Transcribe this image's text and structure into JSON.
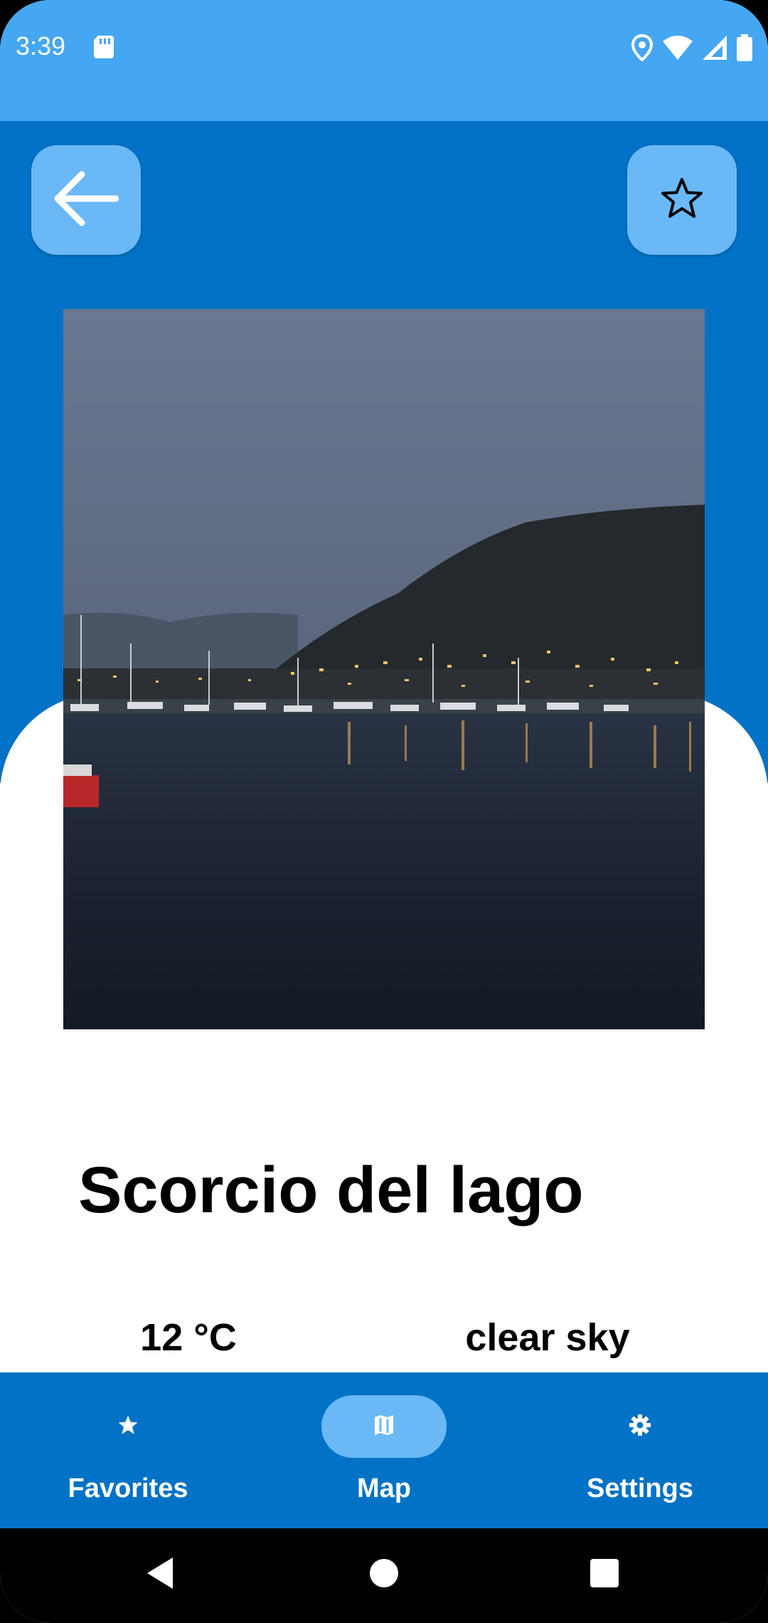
{
  "status_bar": {
    "time": "3:39",
    "icons": [
      "sd-card-icon",
      "location-icon",
      "wifi-icon",
      "signal-icon",
      "battery-icon"
    ]
  },
  "colors": {
    "status_bar": "#45a6f1",
    "header": "#0172c5",
    "button": "#6bb8f7",
    "nav_bar": "#0172c5"
  },
  "header": {
    "back_icon": "arrow-left-icon",
    "favorite_icon": "star-outline-icon"
  },
  "place": {
    "title": "Scorcio del lago",
    "temperature": "12 °C",
    "weather": "clear sky"
  },
  "bottom_nav": {
    "items": [
      {
        "label": "Favorites",
        "icon": "star-icon",
        "active": false
      },
      {
        "label": "Map",
        "icon": "map-icon",
        "active": true
      },
      {
        "label": "Settings",
        "icon": "gear-icon",
        "active": false
      }
    ]
  },
  "system_nav": {
    "icons": [
      "back-triangle-icon",
      "home-circle-icon",
      "recents-square-icon"
    ]
  }
}
